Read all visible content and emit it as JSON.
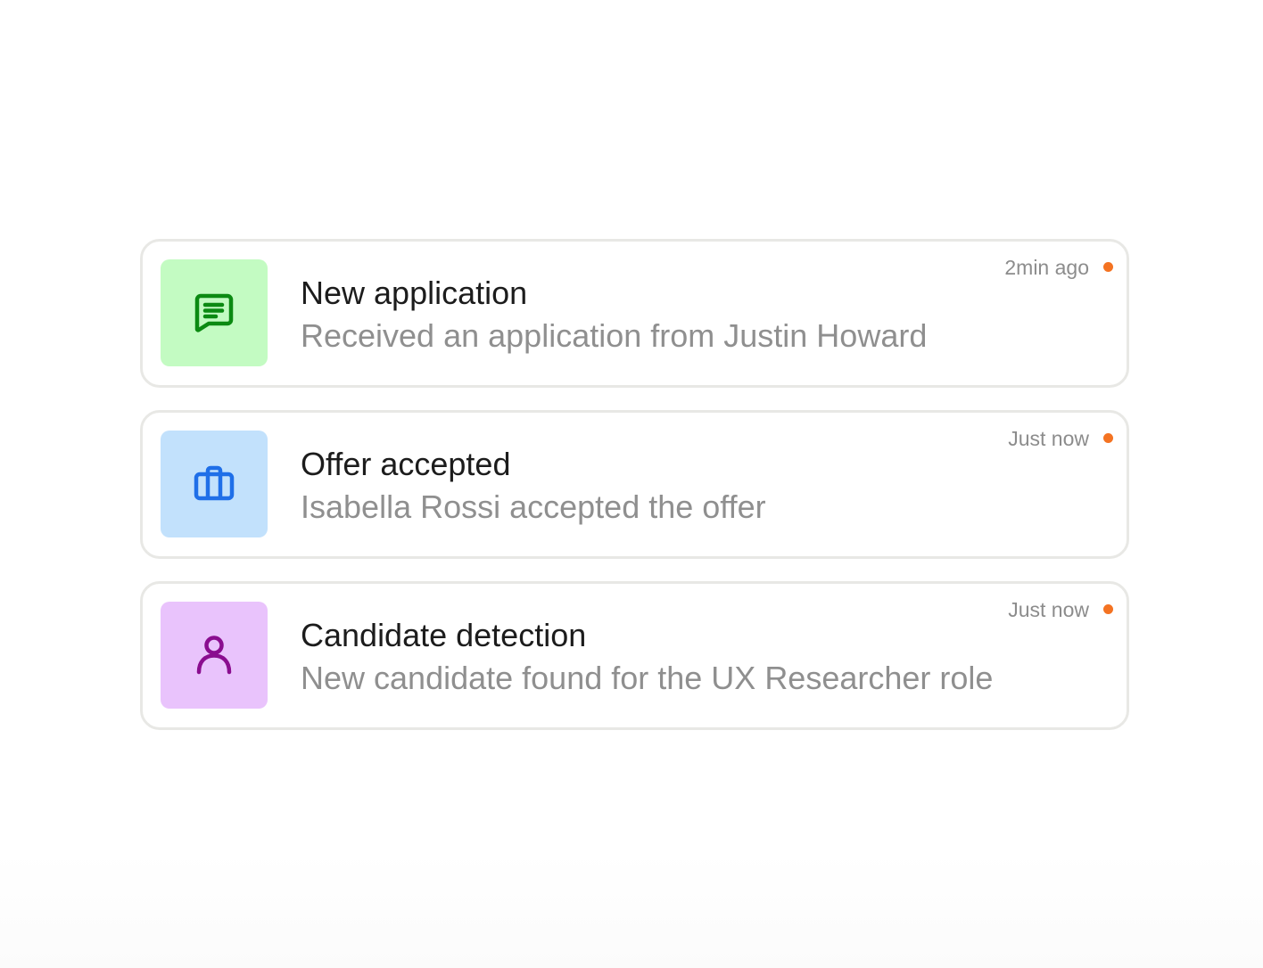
{
  "notifications": [
    {
      "title": "New application",
      "description": "Received an application from Justin Howard",
      "time": "2min ago",
      "icon": "message-lines-icon",
      "tile_color": "#c3fbc2",
      "icon_color": "#0b8a12"
    },
    {
      "title": "Offer accepted",
      "description": "Isabella Rossi accepted the offer",
      "time": "Just now",
      "icon": "briefcase-icon",
      "tile_color": "#c2e1fc",
      "icon_color": "#1f6fe8"
    },
    {
      "title": "Candidate detection",
      "description": "New candidate found for the UX Researcher role",
      "time": "Just now",
      "icon": "user-icon",
      "tile_color": "#e9c3fc",
      "icon_color": "#8a0d8f"
    }
  ],
  "colors": {
    "unread_dot": "#f47322",
    "card_border": "#e8e8e5"
  }
}
